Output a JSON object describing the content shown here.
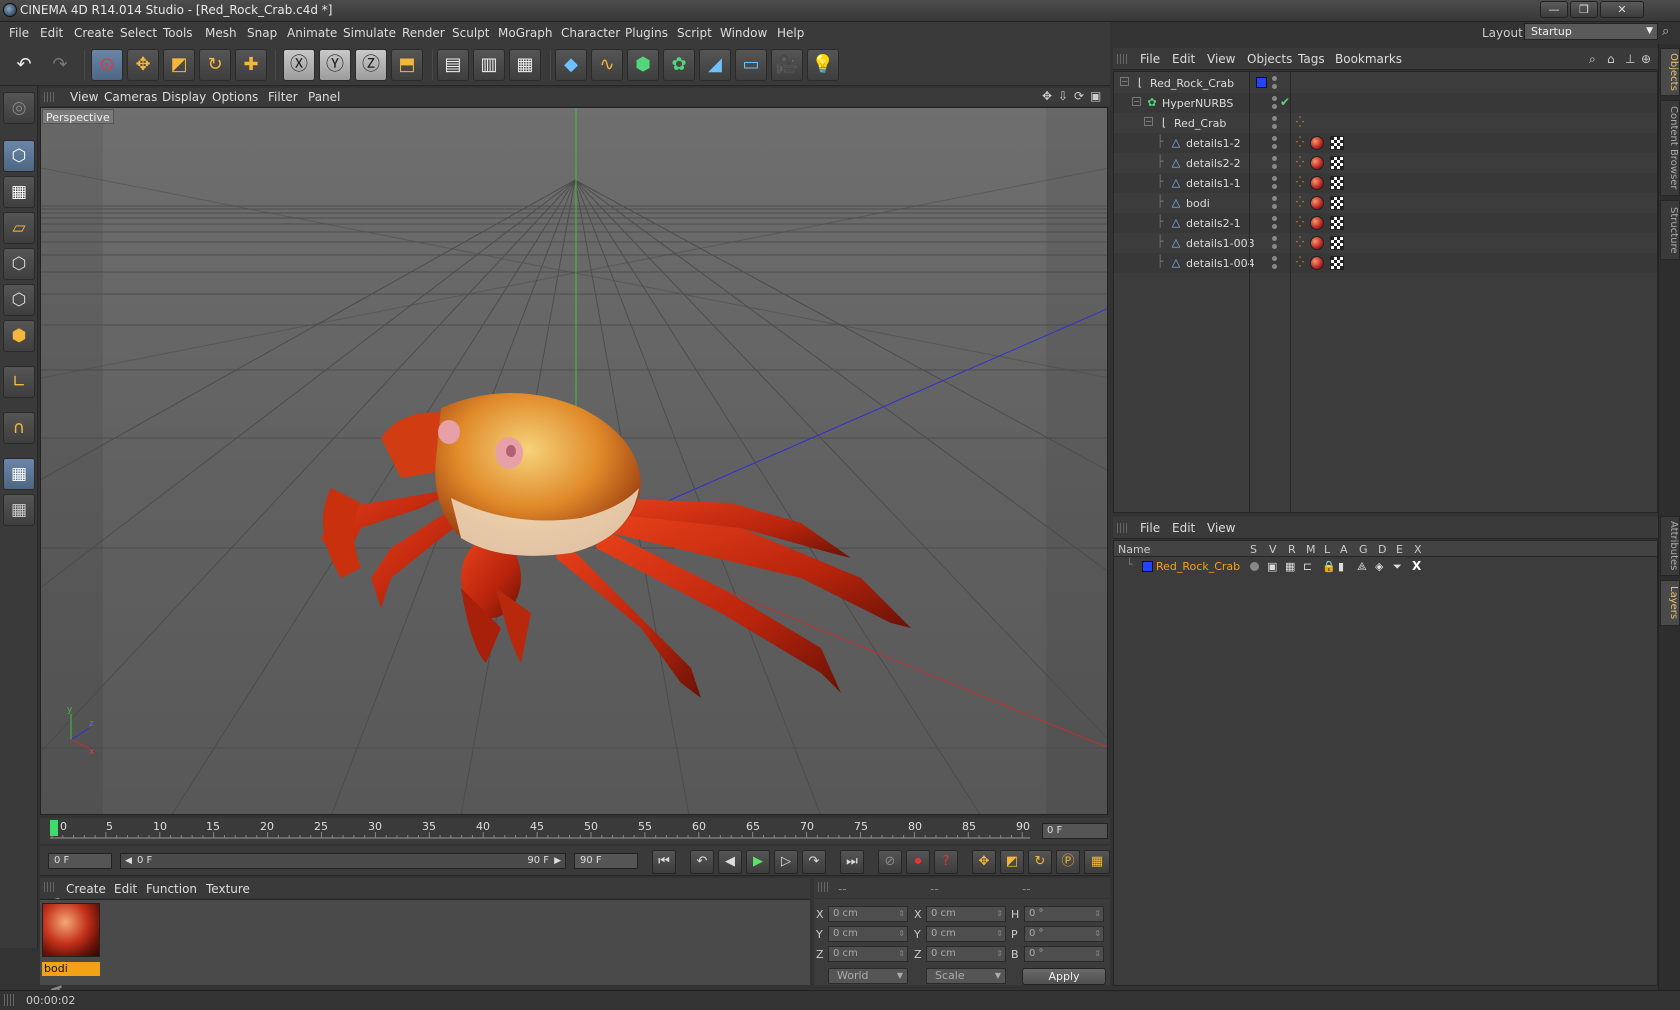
{
  "window": {
    "title": "CINEMA 4D R14.014 Studio - [Red_Rock_Crab.c4d *]",
    "min": "—",
    "max": "❐",
    "close": "✕"
  },
  "menu": [
    "File",
    "Edit",
    "Create",
    "Select",
    "Tools",
    "Mesh",
    "Snap",
    "Animate",
    "Simulate",
    "Render",
    "Sculpt",
    "MoGraph",
    "Character",
    "Plugins",
    "Script",
    "Window",
    "Help"
  ],
  "layout": {
    "label": "Layout:",
    "value": "Startup"
  },
  "viewport": {
    "menu": [
      "View",
      "Cameras",
      "Display",
      "Options",
      "Filter",
      "Panel"
    ],
    "label": "Perspective"
  },
  "timeline": {
    "ticks": [
      "0",
      "5",
      "10",
      "15",
      "20",
      "25",
      "30",
      "35",
      "40",
      "45",
      "50",
      "55",
      "60",
      "65",
      "70",
      "75",
      "80",
      "85",
      "90"
    ],
    "current_frame": "0 F",
    "start_field": "0 F",
    "range_start": "0 F",
    "range_end": "90 F",
    "end_field": "90 F"
  },
  "material": {
    "menu": [
      "Create",
      "Edit",
      "Function",
      "Texture"
    ],
    "name": "bodi"
  },
  "coords": {
    "headers": [
      "--",
      "--",
      "--"
    ],
    "rows": [
      {
        "l1": "X",
        "v1": "0 cm",
        "l2": "X",
        "v2": "0 cm",
        "l3": "H",
        "v3": "0 °"
      },
      {
        "l1": "Y",
        "v1": "0 cm",
        "l2": "Y",
        "v2": "0 cm",
        "l3": "P",
        "v3": "0 °"
      },
      {
        "l1": "Z",
        "v1": "0 cm",
        "l2": "Z",
        "v2": "0 cm",
        "l3": "B",
        "v3": "0 °"
      }
    ],
    "space": "World",
    "mode": "Scale",
    "apply": "Apply"
  },
  "status": {
    "time": "00:00:02"
  },
  "objects": {
    "menu": [
      "File",
      "Edit",
      "View",
      "Objects",
      "Tags",
      "Bookmarks"
    ],
    "items": [
      {
        "name": "Red_Rock_Crab",
        "depth": 0,
        "icon": "null-icon"
      },
      {
        "name": "HyperNURBS",
        "depth": 1,
        "icon": "hypernurbs-icon"
      },
      {
        "name": "Red_Crab",
        "depth": 2,
        "icon": "null-icon"
      },
      {
        "name": "details1-2",
        "depth": 3,
        "icon": "polygon-icon"
      },
      {
        "name": "details2-2",
        "depth": 3,
        "icon": "polygon-icon"
      },
      {
        "name": "details1-1",
        "depth": 3,
        "icon": "polygon-icon"
      },
      {
        "name": "bodi",
        "depth": 3,
        "icon": "polygon-icon"
      },
      {
        "name": "details2-1",
        "depth": 3,
        "icon": "polygon-icon"
      },
      {
        "name": "details1-003",
        "depth": 3,
        "icon": "polygon-icon"
      },
      {
        "name": "details1-004",
        "depth": 3,
        "icon": "polygon-icon"
      }
    ]
  },
  "layers": {
    "menu": [
      "File",
      "Edit",
      "View"
    ],
    "columns": [
      "Name",
      "S",
      "V",
      "R",
      "M",
      "L",
      "A",
      "G",
      "D",
      "E",
      "X"
    ],
    "items": [
      {
        "name": "Red_Rock_Crab",
        "color": "#2244ff"
      }
    ]
  },
  "sidetabs": [
    "Objects",
    "Content Browser",
    "Structure",
    "Attributes",
    "Layers"
  ],
  "colors": {
    "accent": "#f4a215",
    "selected": "#6b86a9",
    "layer_name": "#f4a215"
  }
}
